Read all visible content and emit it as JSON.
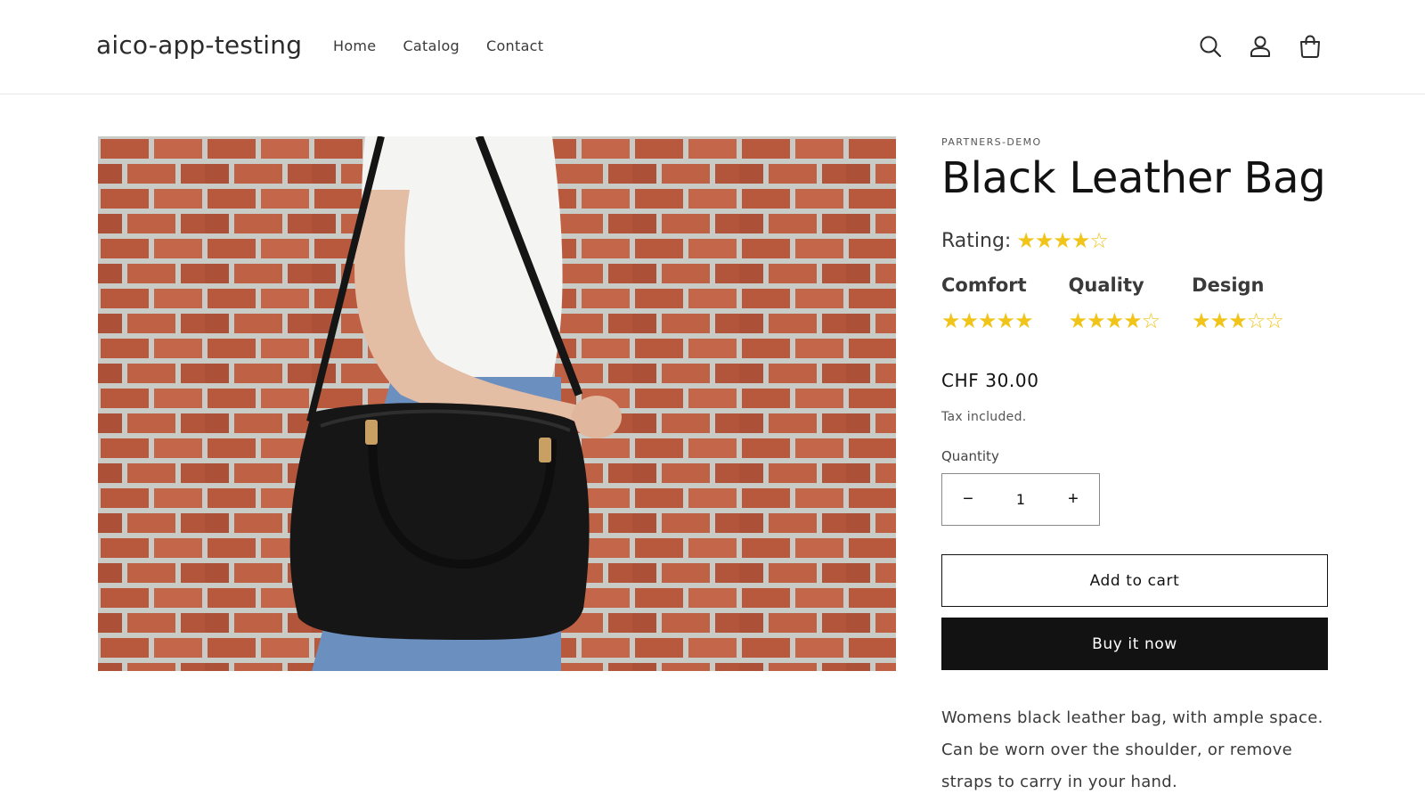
{
  "header": {
    "logo": "aico-app-testing",
    "nav": [
      "Home",
      "Catalog",
      "Contact"
    ],
    "icons": [
      "search-icon",
      "account-icon",
      "cart-icon"
    ]
  },
  "product": {
    "image_alt": "Woman carrying a black leather bag in front of a brick wall",
    "vendor": "PARTNERS-DEMO",
    "title": "Black Leather Bag",
    "rating_label": "Rating:",
    "rating": 4,
    "rating_max": 5,
    "subratings": [
      {
        "label": "Comfort",
        "value": 5
      },
      {
        "label": "Quality",
        "value": 4
      },
      {
        "label": "Design",
        "value": 3
      }
    ],
    "price": "CHF 30.00",
    "tax_note": "Tax included.",
    "quantity_label": "Quantity",
    "quantity": "1",
    "decrement": "−",
    "increment": "+",
    "add_to_cart": "Add to cart",
    "buy_now": "Buy it now",
    "description": "Womens black leather bag, with ample space. Can be worn over the shoulder, or remove straps to carry in your hand."
  },
  "colors": {
    "star": "#f0c419",
    "primary": "#121212",
    "border": "#e6e6e6"
  }
}
